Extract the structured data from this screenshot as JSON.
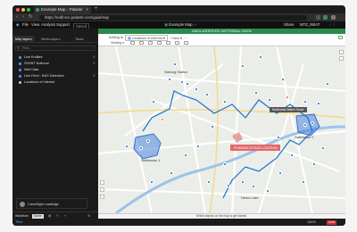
{
  "browser": {
    "tab_title": "Example Map - Palantir",
    "new_tab": "+",
    "url": "https://redforce.palantir.com/gaia/map",
    "close": "×"
  },
  "app": {
    "menu": [
      "File",
      "View",
      "Analysis",
      "Support"
    ],
    "tag": "Saved",
    "document_title": "Example Map",
    "share": "Share",
    "user": "MTZ_NBAT",
    "classification_banner": "UNCLASSIFIED NOTIONAL DATA"
  },
  "sidebar": {
    "tabs": [
      "Map layers",
      "Media layers",
      "Tasks"
    ],
    "filter_placeholder": "Find...",
    "layers": [
      {
        "label": "Live Entities"
      },
      {
        "label": "SIGINT Notional"
      },
      {
        "label": "Intel Data"
      },
      {
        "label": "Live Feed - BAS Detection"
      },
      {
        "label": "Locations of Interest"
      }
    ],
    "card": "CamoSight  Loadedge",
    "workflow_label": "Workflow",
    "workflow_value": "None"
  },
  "map_toolbar": {
    "adding_to": "Adding to",
    "layer": "Locations of Interest",
    "new": "New",
    "mode": "Viewing"
  },
  "map": {
    "labels": {
      "sabong_station": "Sabong Station",
      "safehouse_1": "Safehouse 1",
      "safehouse_2": "Safehouse 2",
      "heron_lake": "Heron Lake",
      "tower_callout": "Northwest Watch Tower",
      "suspected_location": "POSSIBLE ATTACK LOCATION"
    },
    "colors": {
      "route": "#1e6fd0",
      "pin": "#1e6fd0",
      "alert": "#e06a6a",
      "safehouse": "#2d6fd8"
    }
  },
  "status_bar": {
    "text": "Select objects on the map to get started"
  },
  "bottom_bar": {
    "mode": "Pilot",
    "zoom": "100%",
    "live": "Live"
  }
}
